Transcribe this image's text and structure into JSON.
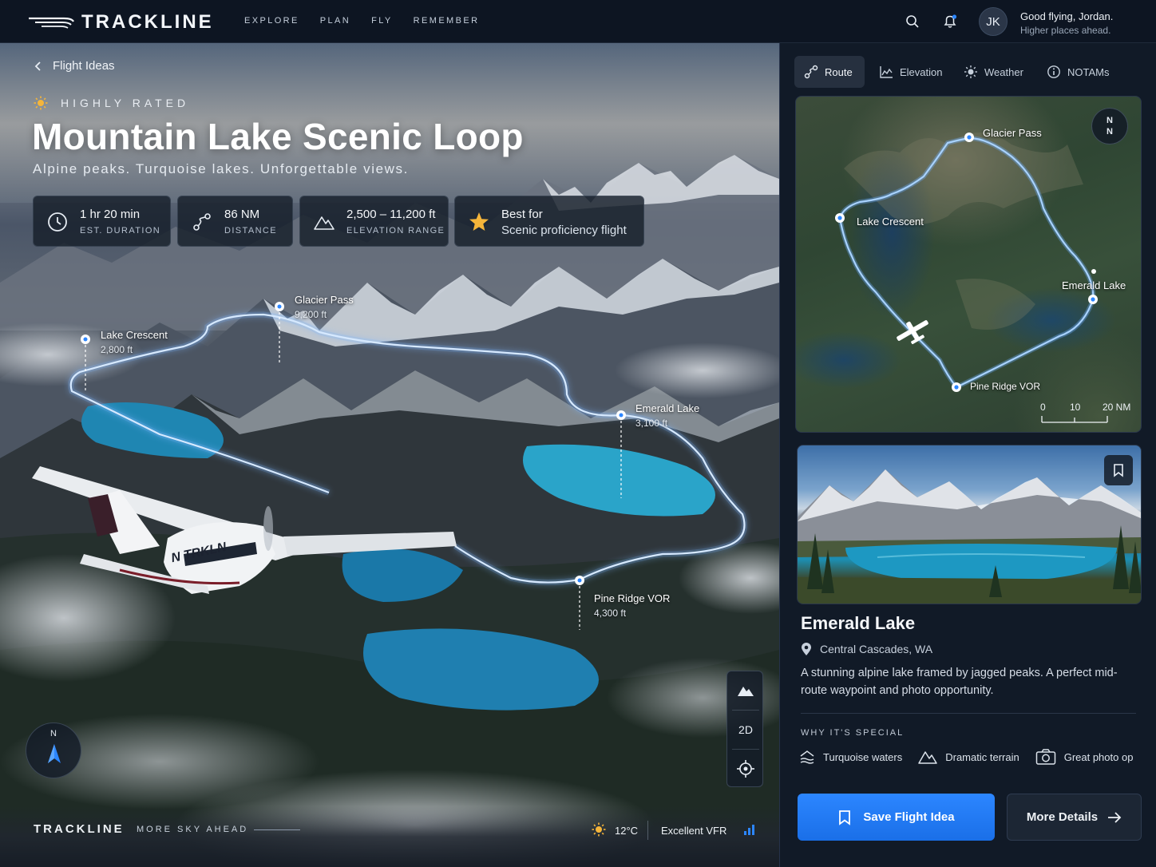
{
  "app": {
    "brand": "TRACKLINE",
    "nav": [
      "EXPLORE",
      "PLAN",
      "FLY",
      "REMEMBER"
    ],
    "avatar_initials": "JK",
    "greeting": "Good flying, Jordan.",
    "greeting_sub": "Higher places ahead."
  },
  "hero": {
    "back_label": "Flight Ideas",
    "rating": "HIGHLY RATED",
    "title": "Mountain Lake Scenic Loop",
    "subtitle": "Alpine peaks. Turquoise lakes. Unforgettable views.",
    "stats": [
      {
        "value": "1 hr 20 min",
        "label": "EST. DURATION",
        "icon": "clock-icon"
      },
      {
        "value": "86 NM",
        "label": "DISTANCE",
        "icon": "route-icon"
      },
      {
        "value": "2,500 – 11,200 ft",
        "label": "ELEVATION RANGE",
        "icon": "mountain-icon"
      },
      {
        "value": "Best for",
        "label": "Scenic proficiency flight",
        "icon": "star-icon"
      }
    ],
    "waypoints": [
      {
        "name": "Lake Crescent",
        "alt": "2,800 ft"
      },
      {
        "name": "Glacier Pass",
        "alt": "9,200 ft"
      },
      {
        "name": "Emerald Lake",
        "alt": "3,100 ft"
      },
      {
        "name": "Pine Ridge VOR",
        "alt": "4,300 ft"
      }
    ],
    "aircraft_reg": "N TRKLN",
    "compass_n": "N",
    "controls": [
      "terrain-icon",
      "2D",
      "locate-icon"
    ]
  },
  "footer": {
    "brand": "TRACKLINE",
    "tagline": "MORE SKY AHEAD",
    "temperature": "12°C",
    "conditions": "Excellent VFR"
  },
  "panel": {
    "tabs": [
      {
        "label": "Route",
        "icon": "route-icon",
        "active": true
      },
      {
        "label": "Elevation",
        "icon": "chart-icon",
        "active": false
      },
      {
        "label": "Weather",
        "icon": "sun-icon",
        "active": false
      },
      {
        "label": "NOTAMs",
        "icon": "info-icon",
        "active": false
      }
    ],
    "minimap": {
      "north": [
        "N",
        "N"
      ],
      "labels": [
        "Glacier Pass",
        "Lake Crescent",
        "Emerald Lake",
        "Pine Ridge VOR"
      ],
      "scale": [
        "0",
        "10",
        "20 NM"
      ]
    },
    "detail": {
      "title": "Emerald Lake",
      "location": "Central Cascades, WA",
      "description": "A stunning alpine lake framed by jagged peaks. A perfect mid-route waypoint and photo opportunity.",
      "why_heading": "WHY IT'S SPECIAL",
      "features": [
        {
          "label": "Turquoise waters",
          "icon": "waves-icon"
        },
        {
          "label": "Dramatic terrain",
          "icon": "mountain-icon"
        },
        {
          "label": "Great photo op",
          "icon": "camera-icon"
        }
      ],
      "save_label": "Save Flight Idea",
      "more_label": "More Details"
    }
  },
  "colors": {
    "accent": "#2c86ff",
    "route_glow": "#8fc4ff",
    "star": "#f5b53a"
  }
}
